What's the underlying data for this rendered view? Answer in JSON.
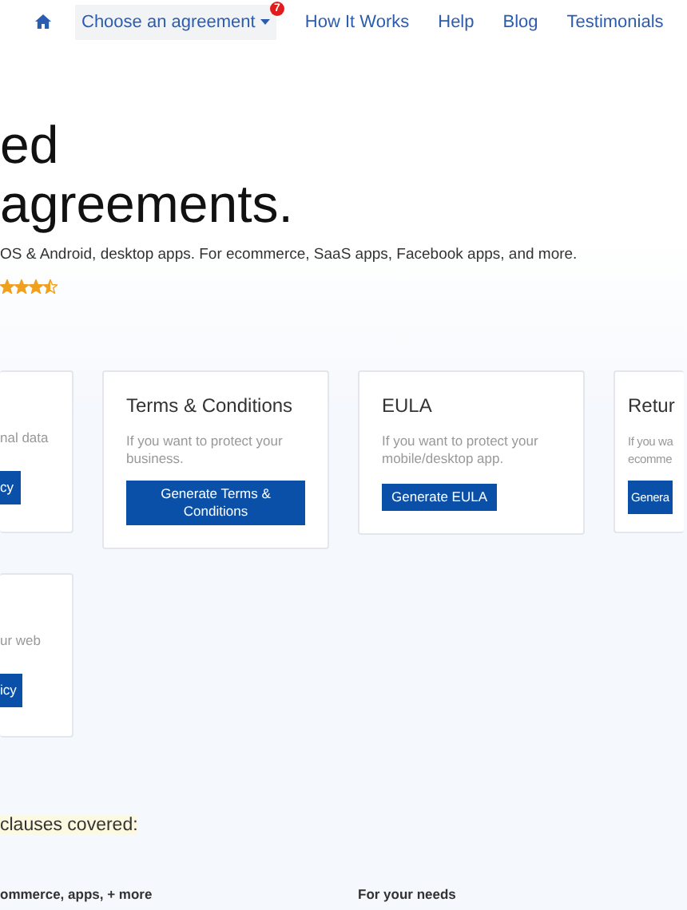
{
  "nav": {
    "items": [
      {
        "kind": "home"
      },
      {
        "kind": "dropdown",
        "label": "Choose an agreement",
        "badge": "7"
      },
      {
        "kind": "link",
        "label": "How It Works"
      },
      {
        "kind": "link",
        "label": "Help"
      },
      {
        "kind": "link",
        "label": "Blog"
      },
      {
        "kind": "link",
        "label": "Testimonials"
      }
    ]
  },
  "hero": {
    "title_lines": [
      "ed",
      "agreements."
    ],
    "subtitle": "OS & Android, desktop apps. For ecommerce, SaaS apps, Facebook apps, and more.",
    "stars": 3.5
  },
  "cards": [
    {
      "kind": "cut-left",
      "description": "nal data",
      "button": "cy"
    },
    {
      "kind": "full",
      "title": "Terms & Conditions",
      "description": "If you want to protect your business.",
      "button": "Generate Terms & Conditions"
    },
    {
      "kind": "full",
      "title": "EULA",
      "description": "If you want to protect your mobile/desktop app.",
      "button": "Generate EULA"
    },
    {
      "kind": "cut-right",
      "title": "Retur",
      "description_lines": [
        "If you wa",
        "ecomme"
      ],
      "button": "Genera"
    },
    {
      "kind": "cut-left",
      "description": "ur web",
      "button": "icy"
    }
  ],
  "clauses": {
    "heading": "clauses covered:",
    "columns": [
      "ommerce, apps, + more",
      "For your needs"
    ]
  }
}
